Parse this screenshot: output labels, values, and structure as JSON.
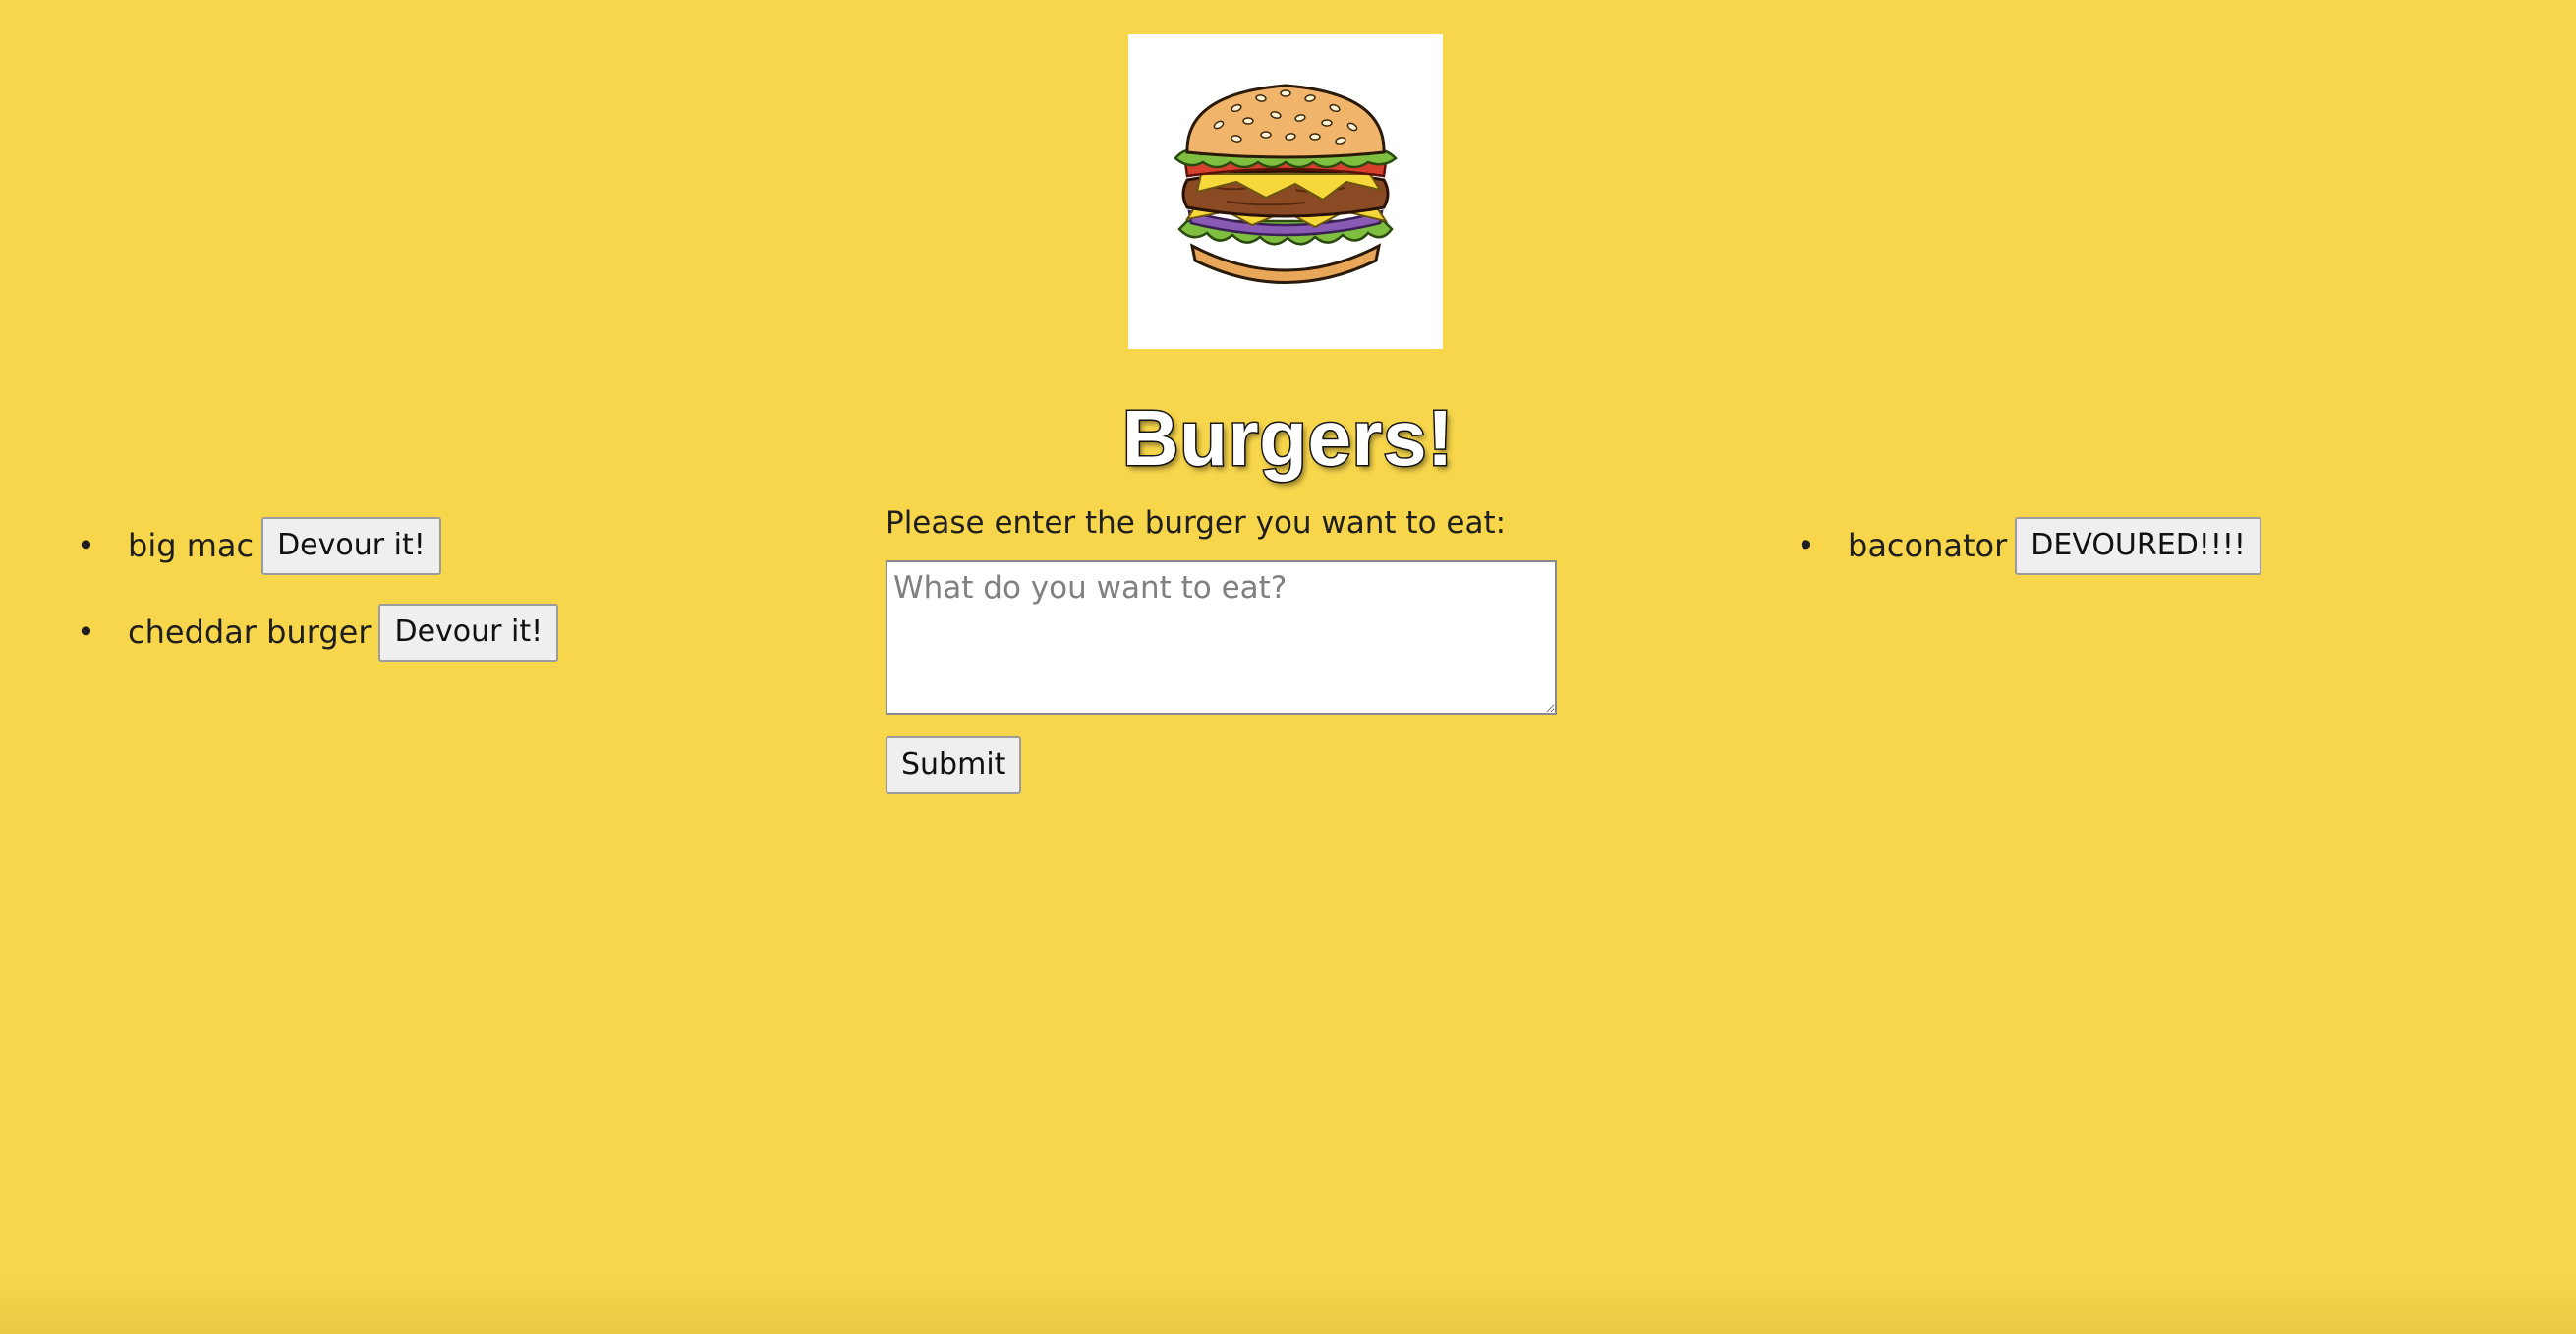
{
  "logo": {
    "icon": "burger-icon",
    "background": "#ffffff"
  },
  "header": {
    "title": "Burgers!"
  },
  "not_devoured": {
    "items": [
      {
        "name": "big mac",
        "button_label": "Devour it!"
      },
      {
        "name": "cheddar burger",
        "button_label": "Devour it!"
      }
    ]
  },
  "form": {
    "label": "Please enter the burger you want to eat:",
    "input_value": "",
    "placeholder": "What do you want to eat?",
    "submit_label": "Submit"
  },
  "devoured": {
    "items": [
      {
        "name": "baconator",
        "button_label": "DEVOURED!!!!"
      }
    ]
  },
  "colors": {
    "background": "#f8d64b",
    "button": "#efefef",
    "title_fill": "#ffffff",
    "title_outline": "#1a1a1a"
  }
}
